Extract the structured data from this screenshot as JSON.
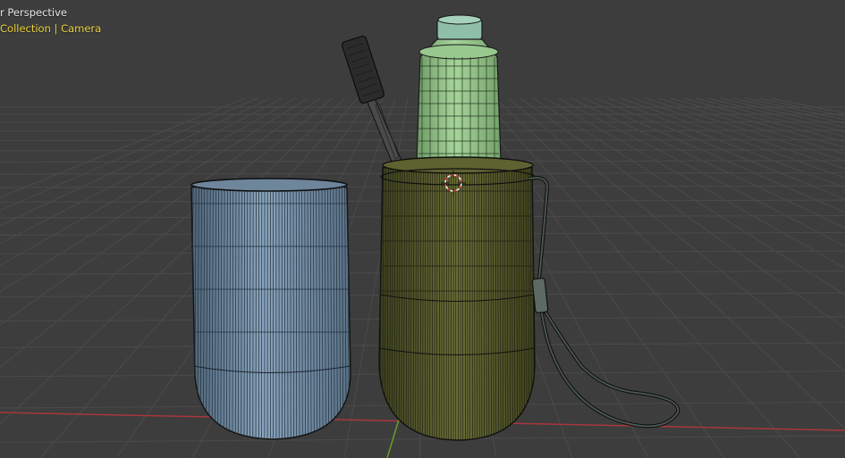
{
  "viewport": {
    "view_label": "r Perspective",
    "collection_label": "Collection | Camera"
  },
  "colors": {
    "background": "#3d3d3d",
    "overlay_text": "#e6e6e6",
    "collection_text": "#e8d23a",
    "x_axis": "#a8363c",
    "y_axis": "#6c9a2a",
    "cup_wire": "#7f9cb6",
    "case_wire": "#6f7437",
    "bottle_wire": "#8dbf85"
  },
  "icons": [
    "3d-cursor-icon"
  ]
}
